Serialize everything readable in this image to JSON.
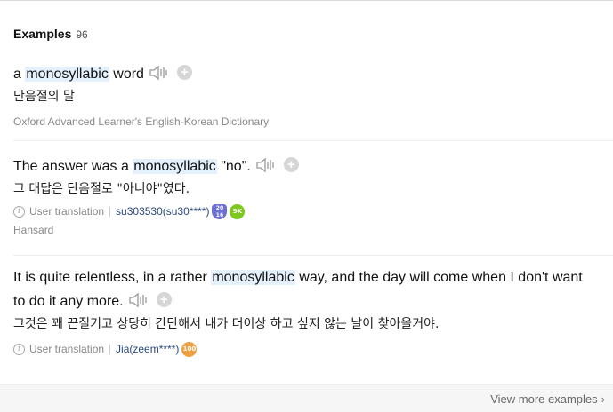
{
  "header": {
    "title": "Examples",
    "count": "96"
  },
  "colors": {
    "highlight": "#e4f1fc",
    "badge_shield": "#6b6fd6",
    "badge_green": "#7cc81e",
    "badge_orange": "#f0a040",
    "link": "#2a4a7c"
  },
  "examples": [
    {
      "sentence_before": "a ",
      "keyword": "monosyllabic",
      "sentence_after": " word",
      "translation": "단음절의 말",
      "source": "Oxford Advanced Learner's English-Korean Dictionary",
      "icons": [
        "speaker-icon",
        "plus-icon"
      ]
    },
    {
      "sentence_before": "The answer was a ",
      "keyword": "monosyllabic",
      "sentence_after": " \"no\".",
      "translation": "그 대답은 단음절로 \"아니야\"였다.",
      "user_translation_label": "User translation",
      "user": "su303530(su30****)",
      "badges": [
        {
          "text": "20\n16",
          "icon": "medal-badge-icon"
        },
        {
          "text": "9K",
          "icon": "level-badge-icon"
        }
      ],
      "source": "Hansard",
      "icons": [
        "speaker-icon",
        "plus-icon"
      ]
    },
    {
      "sentence_before": "It is quite relentless, in a rather ",
      "keyword": "monosyllabic",
      "sentence_after": " way, and the day will come when I don't want to do it any more.",
      "translation": "그것은 꽤 끈질기고 상당히 간단해서 내가 더이상 하고 싶지 않는 날이 찾아올거야.",
      "user_translation_label": "User translation",
      "user": "Jia(zeem****)",
      "badges": [
        {
          "text": "100",
          "icon": "level-badge-icon"
        }
      ],
      "icons": [
        "speaker-icon",
        "plus-icon"
      ]
    }
  ],
  "footer": {
    "more_label": "View more examples"
  }
}
